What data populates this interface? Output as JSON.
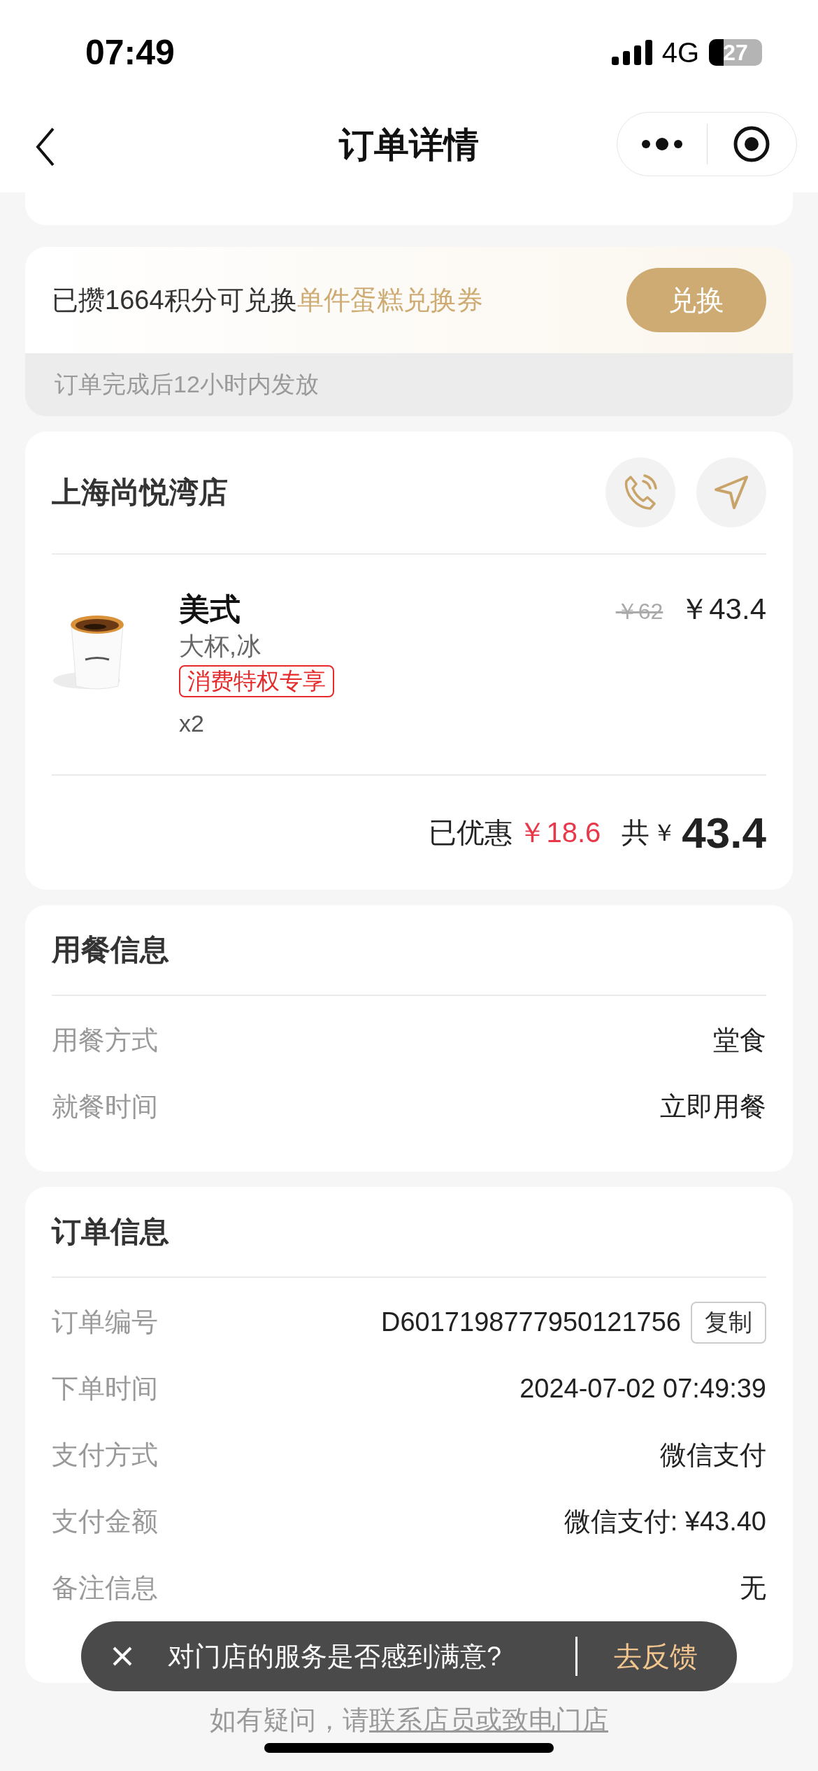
{
  "status_bar": {
    "time": "07:49",
    "network": "4G",
    "battery": "27"
  },
  "nav": {
    "title": "订单详情"
  },
  "points": {
    "text": "已攒1664积分可兑换",
    "highlight": "单件蛋糕兑换券",
    "button": "兑换",
    "note": "订单完成后12小时内发放"
  },
  "store": {
    "name": "上海尚悦湾店",
    "items": [
      {
        "kind": "picture",
        "name": "美式",
        "spec": "大杯,冰",
        "tag": "消费特权专享",
        "quantity": "x2",
        "original_price": "￥62",
        "price": "￥43.4"
      }
    ],
    "discount_label": "已优惠",
    "discount": "￥18.6",
    "total_label": "共",
    "total_currency": "￥",
    "total": "43.4"
  },
  "dining": {
    "title": "用餐信息",
    "rows": [
      {
        "label": "用餐方式",
        "value": "堂食"
      },
      {
        "label": "就餐时间",
        "value": "立即用餐"
      }
    ]
  },
  "order": {
    "title": "订单信息",
    "rows": [
      {
        "label": "订单编号",
        "value": "D6017198777950121756",
        "action": "复制"
      },
      {
        "label": "下单时间",
        "value": "2024-07-02 07:49:39"
      },
      {
        "label": "支付方式",
        "value": "微信支付"
      },
      {
        "label": "支付金额",
        "value": "微信支付: ¥43.40"
      },
      {
        "label": "备注信息",
        "value": "无"
      }
    ]
  },
  "toast": {
    "message": "对门店的服务是否感到满意?",
    "action": "去反馈"
  },
  "footer": {
    "text": "如有疑问，请",
    "link": "联系店员或致电门店"
  }
}
